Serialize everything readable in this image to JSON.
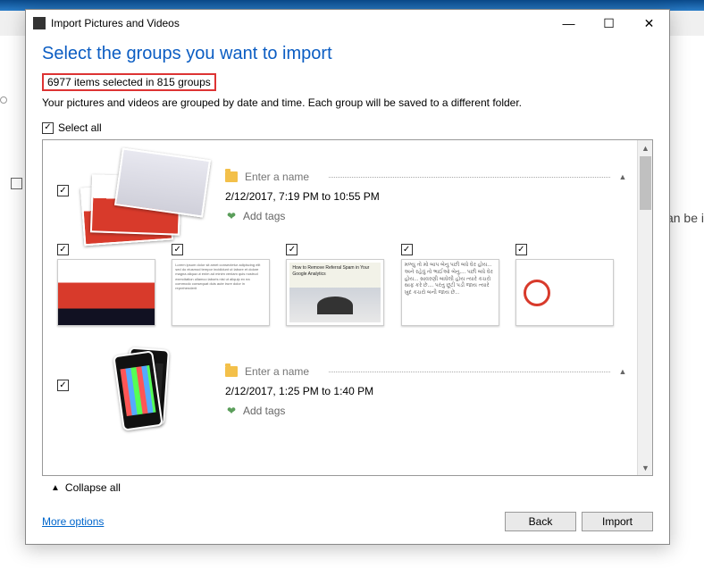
{
  "window": {
    "title": "Import Pictures and Videos",
    "minimize": "—",
    "maximize": "☐",
    "close": "✕"
  },
  "heading": "Select the groups you want to import",
  "status": "6977 items selected in 815 groups",
  "subtext": "Your pictures and videos are grouped by date and time. Each group will be saved to a different folder.",
  "select_all_label": "Select all",
  "select_all_checked": "✓",
  "groups": [
    {
      "name_placeholder": "Enter a name",
      "date_range": "2/12/2017, 7:19 PM to 10:55 PM",
      "add_tags": "Add tags",
      "checked": "✓",
      "expand": "▲"
    },
    {
      "name_placeholder": "Enter a name",
      "date_range": "2/12/2017, 1:25 PM to 1:40 PM",
      "add_tags": "Add tags",
      "checked": "✓",
      "expand": "▲"
    }
  ],
  "thumbs_checked": "✓",
  "thumb_text_gujarati": "મળ્યુ તો મો બાપ બેનુ પછી\nબધે ઘેર હોય...\nઅને રહેવું તો ભાઈઓ બેનુ....\nપછી બધે ઘેર હોય...\nસાવરણી બાધેલી હોય ત્યારે\nકચરો સાફ કરે છે....\nપરંતુ છૂટી પડી જાય ત્યારે ખુદ\nકચરો બની જાય છે...",
  "thumb_google": "How to Remove Referral Spam in Your Google Analytics",
  "collapse_label": "Collapse all",
  "more_options": "More options",
  "buttons": {
    "back": "Back",
    "import": "Import"
  },
  "bg_text": "an be i"
}
